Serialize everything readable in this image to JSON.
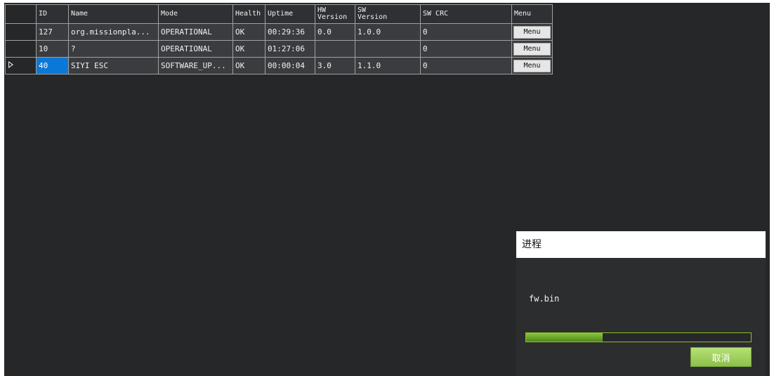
{
  "grid": {
    "columns": [
      "ID",
      "Name",
      "Mode",
      "Health",
      "Uptime",
      "HW\nVersion",
      "SW\nVersion",
      "SW CRC",
      "Menu"
    ],
    "rows": [
      {
        "id": "127",
        "name": "org.missionpla...",
        "mode": "OPERATIONAL",
        "health": "OK",
        "uptime": "00:29:36",
        "hw": "0.0",
        "sw": "1.0.0",
        "crc": "0",
        "menu": "Menu",
        "selected": false
      },
      {
        "id": "10",
        "name": "?",
        "mode": "OPERATIONAL",
        "health": "OK",
        "uptime": "01:27:06",
        "hw": "",
        "sw": "",
        "crc": "0",
        "menu": "Menu",
        "selected": false
      },
      {
        "id": "40",
        "name": "SIYI ESC",
        "mode": "SOFTWARE_UP...",
        "health": "OK",
        "uptime": "00:00:04",
        "hw": "3.0",
        "sw": "1.1.0",
        "crc": "0",
        "menu": "Menu",
        "selected": true
      }
    ]
  },
  "dialog": {
    "title": "进程",
    "filename": "fw.bin",
    "progress_percent": 34,
    "cancel_label": "取消",
    "accent_color": "#8cc63f"
  },
  "colors": {
    "background": "#262729",
    "selection": "#0a78d7"
  }
}
